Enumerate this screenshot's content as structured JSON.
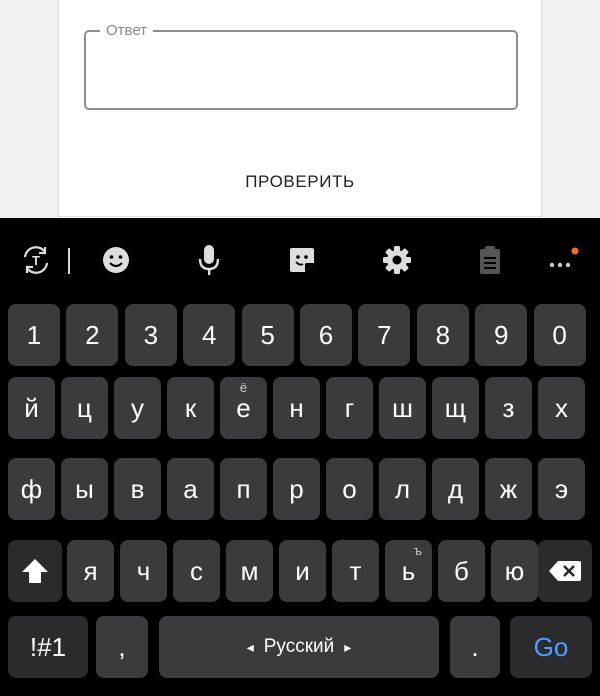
{
  "form": {
    "answer_label": "Ответ",
    "answer_value": "",
    "check_label": "ПРОВЕРИТЬ"
  },
  "keyboard": {
    "toolbar": [
      "text-mode-icon",
      "emoji-icon",
      "microphone-icon",
      "sticker-icon",
      "settings-icon",
      "clipboard-icon",
      "more-icon"
    ],
    "notification_dot_color": "#ff6a2a",
    "rows": {
      "numbers": [
        "1",
        "2",
        "3",
        "4",
        "5",
        "6",
        "7",
        "8",
        "9",
        "0"
      ],
      "row1": [
        "й",
        "ц",
        "у",
        "к",
        "е",
        "н",
        "г",
        "ш",
        "щ",
        "з",
        "х"
      ],
      "row1_alt": {
        "е": "ё"
      },
      "row2": [
        "ф",
        "ы",
        "в",
        "а",
        "п",
        "р",
        "о",
        "л",
        "д",
        "ж",
        "э"
      ],
      "row3": [
        "я",
        "ч",
        "с",
        "м",
        "и",
        "т",
        "ь",
        "б",
        "ю"
      ],
      "row3_alt": {
        "ь": "ъ"
      }
    },
    "symbols_label": "!#1",
    "comma": ",",
    "space_label": "Русский",
    "space_left_arrow": "◂",
    "space_right_arrow": "▸",
    "period": ".",
    "go_label": "Go",
    "go_color": "#4a9fff"
  }
}
